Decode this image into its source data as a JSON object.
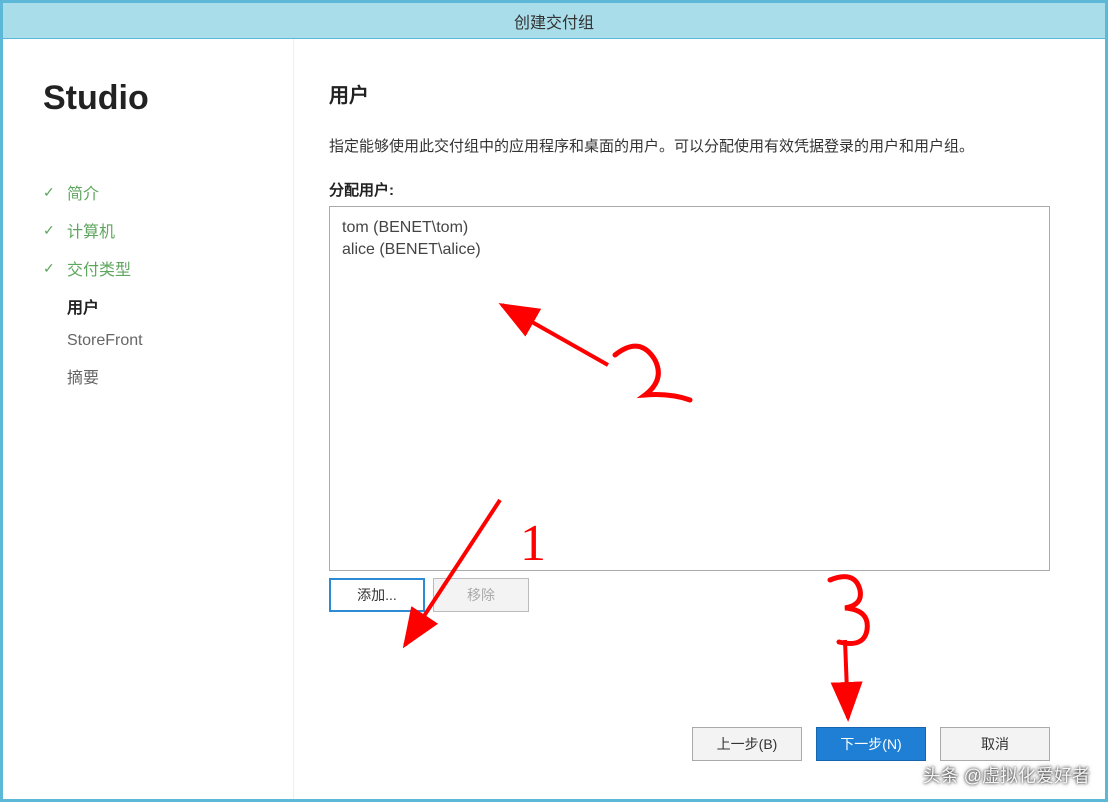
{
  "window": {
    "title": "创建交付组"
  },
  "sidebar": {
    "brand": "Studio",
    "steps": [
      {
        "label": "简介",
        "state": "done"
      },
      {
        "label": "计算机",
        "state": "done"
      },
      {
        "label": "交付类型",
        "state": "done"
      },
      {
        "label": "用户",
        "state": "current"
      },
      {
        "label": "StoreFront",
        "state": "pending"
      },
      {
        "label": "摘要",
        "state": "pending"
      }
    ]
  },
  "main": {
    "title": "用户",
    "description": "指定能够使用此交付组中的应用程序和桌面的用户。可以分配使用有效凭据登录的用户和用户组。",
    "list_label": "分配用户:",
    "users": [
      "tom (BENET\\tom)",
      "alice (BENET\\alice)"
    ],
    "add_label": "添加...",
    "remove_label": "移除"
  },
  "footer": {
    "back": "上一步(B)",
    "next": "下一步(N)",
    "cancel": "取消"
  },
  "annotations": {
    "n1": "1",
    "n2": "2",
    "n3": "3"
  },
  "watermark": "头条 @虚拟化爱好者"
}
